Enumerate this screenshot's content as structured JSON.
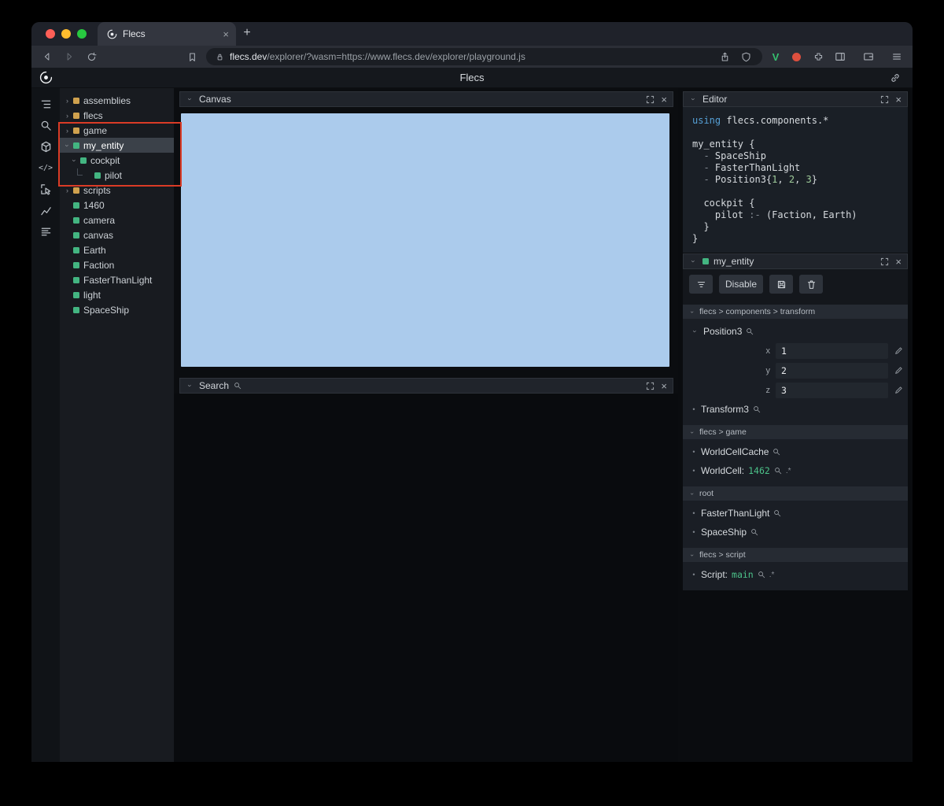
{
  "glyphs": {
    "chevron": "›",
    "bullet": "•",
    "close": "×",
    "plus": "+",
    "v_badge": "V",
    "code_glyph": "</>"
  },
  "colors": {
    "accent_green": "#43b581",
    "module_yellow": "#cfa14e",
    "canvas_blue": "#abcbec",
    "annotation_red": "#da3b26",
    "value_green": "#4cc38a",
    "keyword_blue": "#56a0d6"
  },
  "chrome": {
    "tab": {
      "title": "Flecs"
    },
    "url": {
      "domain": "flecs.dev",
      "path": "/explorer/?wasm=https://www.flecs.dev/explorer/playground.js"
    }
  },
  "header": {
    "title": "Flecs"
  },
  "sidebar": {
    "icons": [
      {
        "name": "tree-icon",
        "icon": "tree"
      },
      {
        "name": "search-icon",
        "icon": "magnifier"
      },
      {
        "name": "cube-icon",
        "icon": "cube"
      },
      {
        "name": "code-icon",
        "glyph": "</>"
      },
      {
        "name": "inspect-icon",
        "icon": "inspect"
      },
      {
        "name": "chart-icon",
        "icon": "chart"
      },
      {
        "name": "stats-icon",
        "icon": "stats"
      }
    ]
  },
  "tree": {
    "items": [
      {
        "label": "assemblies",
        "square": "yellow",
        "chev": "collapsed",
        "indent": 0,
        "selected": false
      },
      {
        "label": "flecs",
        "square": "yellow",
        "chev": "collapsed",
        "indent": 0,
        "selected": false
      },
      {
        "label": "game",
        "square": "yellow",
        "chev": "collapsed",
        "indent": 0,
        "selected": false
      },
      {
        "label": "my_entity",
        "square": "green",
        "chev": "expanded",
        "indent": 0,
        "selected": true
      },
      {
        "label": "cockpit",
        "square": "green",
        "chev": "expanded",
        "indent": 1,
        "selected": false
      },
      {
        "label": "pilot",
        "square": "green",
        "chev": "none",
        "indent": 2,
        "selected": false
      },
      {
        "label": "scripts",
        "square": "yellow",
        "chev": "collapsed",
        "indent": 0,
        "selected": false
      },
      {
        "label": "1460",
        "square": "green",
        "chev": "none",
        "indent": 0,
        "selected": false
      },
      {
        "label": "camera",
        "square": "green",
        "chev": "none",
        "indent": 0,
        "selected": false
      },
      {
        "label": "canvas",
        "square": "green",
        "chev": "none",
        "indent": 0,
        "selected": false
      },
      {
        "label": "Earth",
        "square": "green",
        "chev": "none",
        "indent": 0,
        "selected": false
      },
      {
        "label": "Faction",
        "square": "green",
        "chev": "none",
        "indent": 0,
        "selected": false
      },
      {
        "label": "FasterThanLight",
        "square": "green",
        "chev": "none",
        "indent": 0,
        "selected": false
      },
      {
        "label": "light",
        "square": "green",
        "chev": "none",
        "indent": 0,
        "selected": false
      },
      {
        "label": "SpaceShip",
        "square": "green",
        "chev": "none",
        "indent": 0,
        "selected": false
      }
    ]
  },
  "panels": {
    "canvas": {
      "title": "Canvas"
    },
    "search": {
      "title": "Search"
    },
    "editor": {
      "title": "Editor"
    },
    "inspector": {
      "title": "my_entity"
    }
  },
  "editor": {
    "lines": [
      [
        {
          "c": "kw",
          "t": "using"
        },
        {
          "c": "plain",
          "t": " flecs.components.*"
        }
      ],
      [],
      [
        {
          "c": "plain",
          "t": "my_entity {"
        }
      ],
      [
        {
          "c": "dim",
          "t": "  - "
        },
        {
          "c": "plain",
          "t": "SpaceShip"
        }
      ],
      [
        {
          "c": "dim",
          "t": "  - "
        },
        {
          "c": "plain",
          "t": "FasterThanLight"
        }
      ],
      [
        {
          "c": "dim",
          "t": "  - "
        },
        {
          "c": "plain",
          "t": "Position3{"
        },
        {
          "c": "num",
          "t": "1"
        },
        {
          "c": "plain",
          "t": ", "
        },
        {
          "c": "num",
          "t": "2"
        },
        {
          "c": "plain",
          "t": ", "
        },
        {
          "c": "num",
          "t": "3"
        },
        {
          "c": "plain",
          "t": "}"
        }
      ],
      [],
      [
        {
          "c": "plain",
          "t": "  cockpit {"
        }
      ],
      [
        {
          "c": "plain",
          "t": "    pilot "
        },
        {
          "c": "dim",
          "t": ":- "
        },
        {
          "c": "plain",
          "t": "(Faction, Earth)"
        }
      ],
      [
        {
          "c": "plain",
          "t": "  }"
        }
      ],
      [
        {
          "c": "plain",
          "t": "}"
        }
      ]
    ]
  },
  "inspector": {
    "toolbar": {
      "disable_label": "Disable"
    },
    "sections": [
      {
        "path": "flecs > components > transform",
        "rows": [
          {
            "type": "component",
            "name": "Position3",
            "expanded": true
          },
          {
            "type": "field",
            "key": "x",
            "value": "1"
          },
          {
            "type": "field",
            "key": "y",
            "value": "2"
          },
          {
            "type": "field",
            "key": "z",
            "value": "3"
          },
          {
            "type": "component",
            "name": "Transform3"
          }
        ]
      },
      {
        "path": "flecs > game",
        "rows": [
          {
            "type": "component",
            "name": "WorldCellCache"
          },
          {
            "type": "component",
            "name": "WorldCell:",
            "value": "1462",
            "suffix": ".*"
          }
        ]
      },
      {
        "path": "root",
        "rows": [
          {
            "type": "component",
            "name": "FasterThanLight"
          },
          {
            "type": "component",
            "name": "SpaceShip"
          }
        ]
      },
      {
        "path": "flecs > script",
        "rows": [
          {
            "type": "component",
            "name": "Script:",
            "value": "main",
            "suffix": ".*"
          }
        ]
      }
    ]
  }
}
